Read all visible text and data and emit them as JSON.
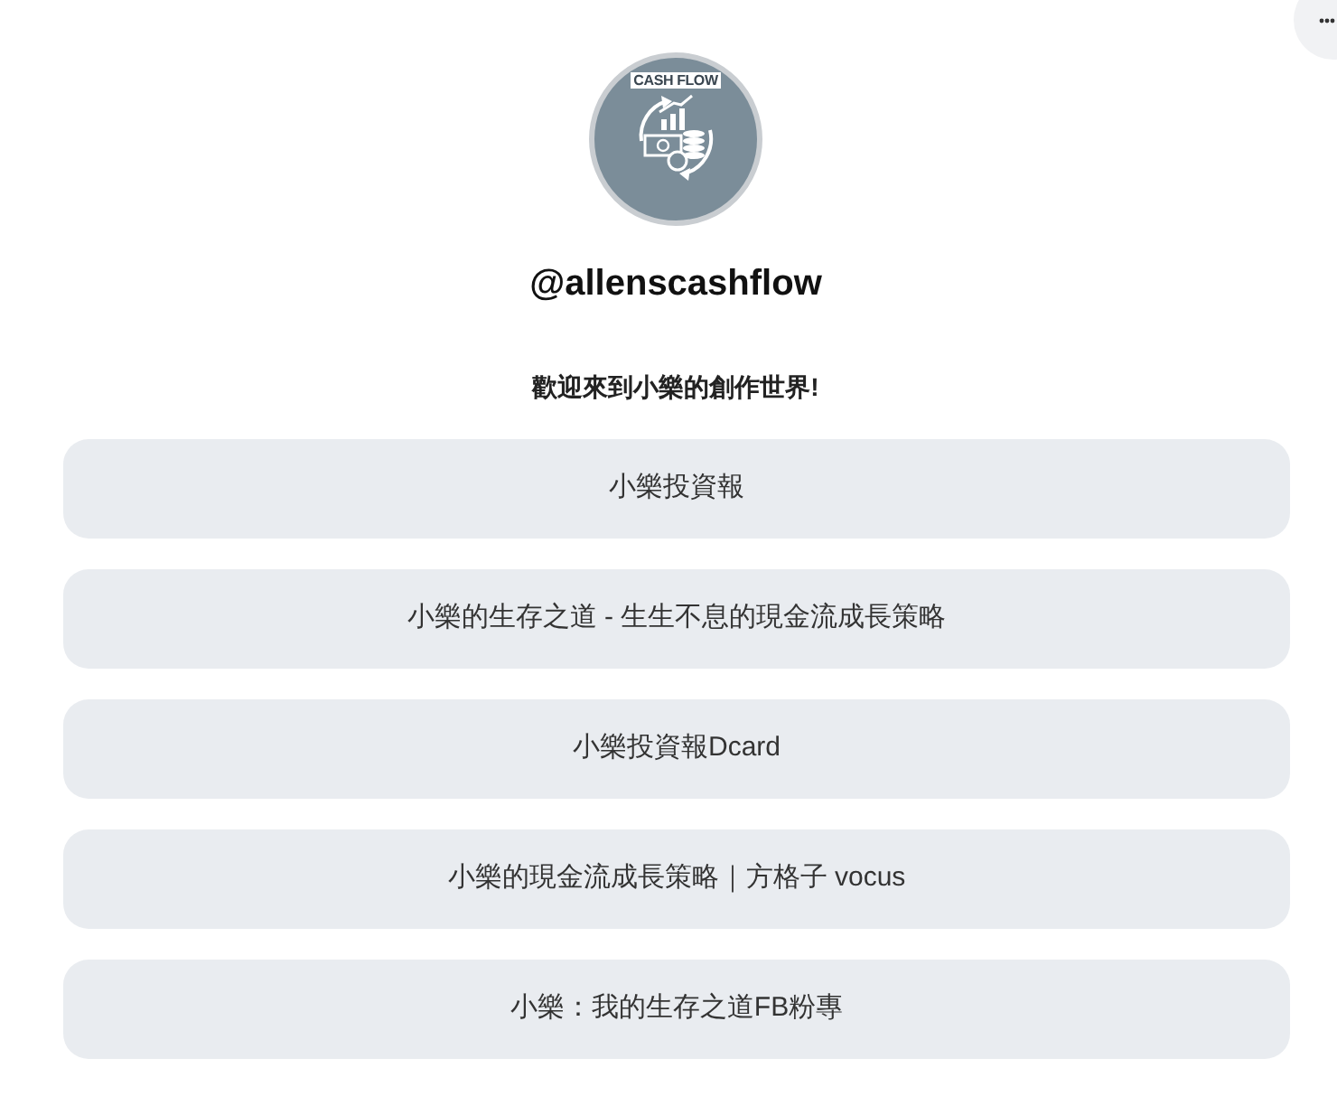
{
  "profile": {
    "logo_text": "CASH FLOW",
    "username": "@allenscashflow",
    "bio": "歡迎來到小樂的創作世界!"
  },
  "links": [
    {
      "label": "小樂投資報"
    },
    {
      "label": "小樂的生存之道 - 生生不息的現金流成長策略"
    },
    {
      "label": "小樂投資報Dcard"
    },
    {
      "label": "小樂的現金流成長策略｜方格子 vocus"
    },
    {
      "label": "小樂：我的生存之道FB粉專"
    }
  ]
}
